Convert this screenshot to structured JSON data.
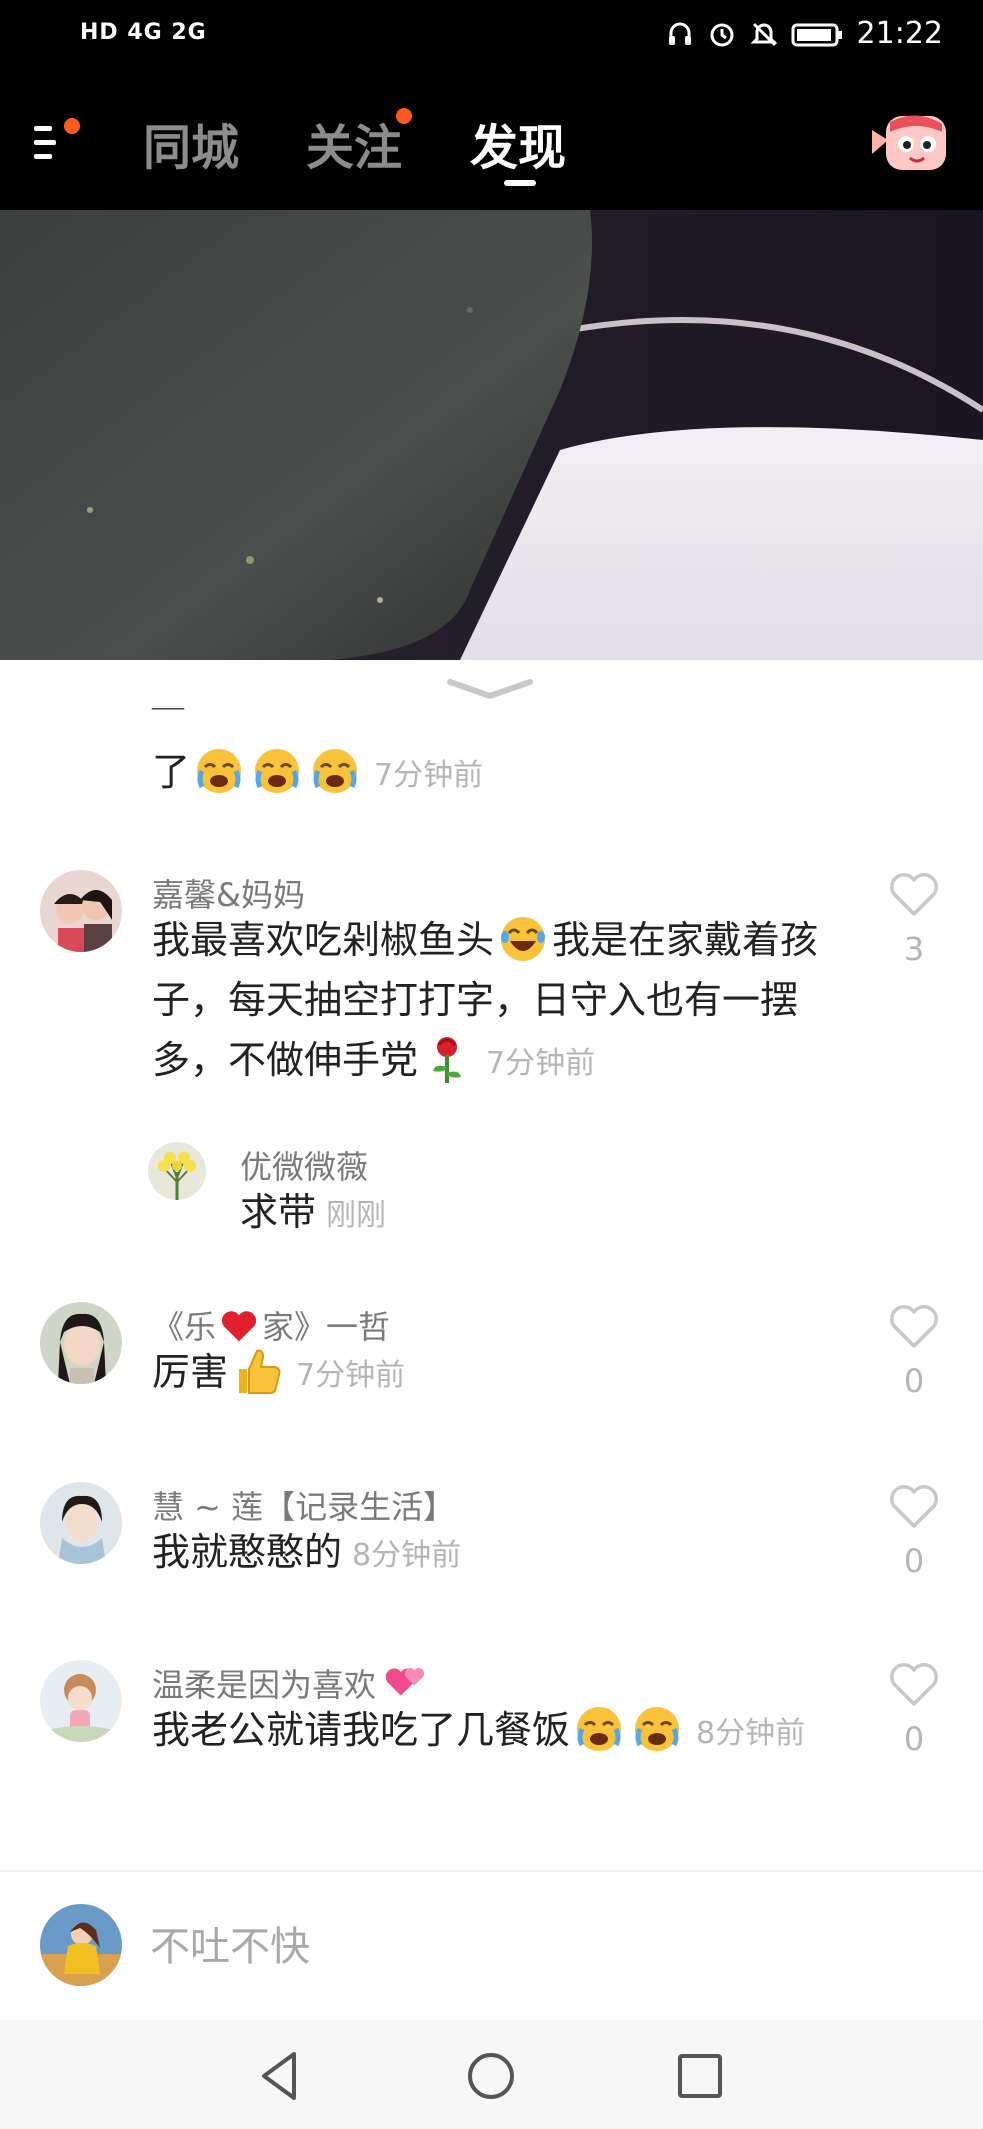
{
  "status_bar": {
    "left_text": "HD 4G 2G",
    "time": "21:22"
  },
  "nav": {
    "tabs": [
      "同城",
      "关注",
      "发现"
    ],
    "active_tab": "发现"
  },
  "comments": [
    {
      "id": "partial",
      "text": "了",
      "time": "7分钟前"
    },
    {
      "id": "c1",
      "username": "嘉馨&妈妈",
      "text_a": "我最喜欢吃剁椒鱼头",
      "text_b": "我是在家戴着孩子，每天抽空打打字，日守入也有一摆多，不做伸手党",
      "time": "7分钟前",
      "likes": "3"
    },
    {
      "id": "r1",
      "username": "优微微薇",
      "text": "求带",
      "time": "刚刚"
    },
    {
      "id": "c2",
      "username_a": "《乐",
      "username_b": "家》一哲",
      "text": "厉害",
      "time": "7分钟前",
      "likes": "0"
    },
    {
      "id": "c3",
      "username": "慧 ~ 莲【记录生活】",
      "text": "我就憨憨的",
      "time": "8分钟前",
      "likes": "0"
    },
    {
      "id": "c4",
      "username": "温柔是因为喜欢",
      "text": "我老公就请我吃了几餐饭",
      "time": "8分钟前",
      "likes": "0"
    }
  ],
  "input": {
    "placeholder": "不吐不快"
  },
  "icons": {
    "status": [
      "headset-icon",
      "alarm-icon",
      "mute-icon",
      "battery-icon"
    ],
    "nav": [
      "menu-icon",
      "mascot-icon"
    ],
    "emoji": [
      "cry-emoji",
      "laugh-emoji",
      "rose-emoji",
      "thumbs-up-emoji",
      "heart-emoji",
      "hearts-emoji"
    ],
    "android": [
      "back-icon",
      "home-icon",
      "recents-icon"
    ]
  },
  "colors": {
    "accent": "#ff5a1f",
    "nav_bg": "#000000",
    "muted_text": "#b5b5b5"
  }
}
